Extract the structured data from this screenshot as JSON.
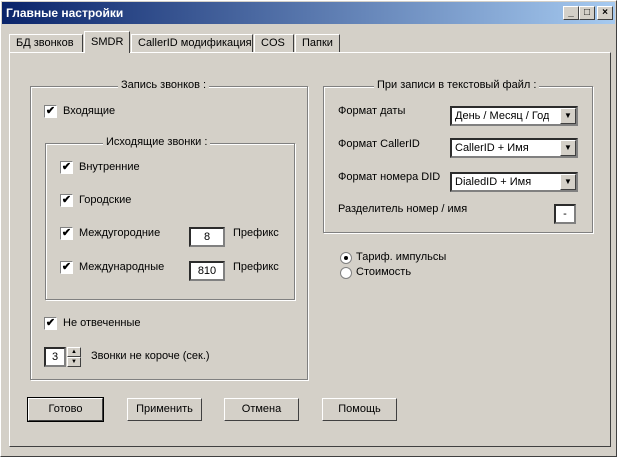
{
  "window": {
    "title": "Главные настройки",
    "min": "_",
    "max": "□",
    "close": "×"
  },
  "tabs": [
    "БД звонков",
    "SMDR",
    "CallerID модификация",
    "COS",
    "Папки"
  ],
  "record": {
    "group_title": "Запись звонков :",
    "incoming": "Входящие",
    "outgoing_title": "Исходящие звонки :",
    "internal": "Внутренние",
    "city": "Городские",
    "longdistance": "Междугородние",
    "longdistance_prefix_value": "8",
    "international": "Международные",
    "international_prefix_value": "810",
    "prefix_label": "Префикс",
    "unanswered": "Не отвеченные",
    "min_duration_value": "3",
    "min_duration_label": "Звонки не короче (сек.)"
  },
  "text_file": {
    "group_title": "При записи в текстовый файл :",
    "date_format_label": "Формат даты",
    "date_format_value": "День / Месяц / Год",
    "callerid_label": "Формат CallerID",
    "callerid_value": "CallerID + Имя",
    "did_label": "Формат номера DID",
    "did_value": "DialedID + Имя",
    "separator_label": "Разделитель номер / имя",
    "separator_value": "-"
  },
  "tariff": {
    "pulses": "Тариф. импульсы",
    "cost": "Стоимость"
  },
  "buttons": {
    "ok": "Готово",
    "apply": "Применить",
    "cancel": "Отмена",
    "help": "Помощь"
  },
  "check_mark": "✔"
}
